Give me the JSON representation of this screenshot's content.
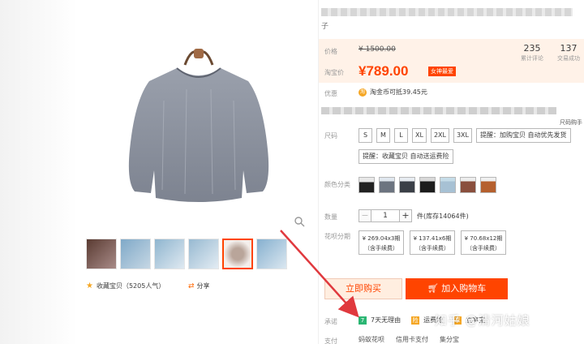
{
  "product": {
    "title_suffix": "子",
    "favorite_text": "收藏宝贝（5205人气）",
    "share_text": "分享"
  },
  "price": {
    "label_price": "价格",
    "original": "¥ 1500.00",
    "label_taobao": "淘宝价",
    "taobao": "¥789.00",
    "badge": "女神最爱",
    "reviews_count": "235",
    "reviews_label": "累计评论",
    "sales_count": "137",
    "sales_label": "交易成功"
  },
  "promo": {
    "label": "优惠",
    "coin_icon": "淘",
    "coins_text": "淘金币可抵39.45元"
  },
  "buyer_note": "尺码购手",
  "size": {
    "label": "尺码",
    "options": [
      "S",
      "M",
      "L",
      "XL",
      "2XL",
      "3XL"
    ],
    "hint_cart": "提醒：加购宝贝 自动优先发货",
    "hint_fav": "提醒：收藏宝贝 自动送运费险"
  },
  "color": {
    "label": "颜色分类"
  },
  "quantity": {
    "label": "数量",
    "minus": "−",
    "value": "1",
    "plus": "+",
    "stock": "件(库存14064件)"
  },
  "installment": {
    "label": "花呗分期",
    "options": [
      {
        "amount": "¥ 269.04x3期",
        "fee": "（含手续费）"
      },
      {
        "amount": "¥ 137.41x6期",
        "fee": "（含手续费）"
      },
      {
        "amount": "¥ 70.68x12期",
        "fee": "（含手续费）"
      }
    ]
  },
  "actions": {
    "buy_now": "立即购买",
    "add_cart": "加入购物车"
  },
  "promise": {
    "label": "承诺",
    "return_icon": "7",
    "return_text": "7天无理由",
    "insurance_text": "运费险",
    "other_text": "立享宝"
  },
  "payment": {
    "label": "支付",
    "items": [
      "蚂蚁花呗",
      "信用卡支付",
      "集分宝"
    ]
  },
  "watermark": "知乎 @清河姑娘",
  "colors": {
    "accent": "#ff4400",
    "price_bg": "#fff2e8",
    "arrow": "#e0393e"
  }
}
